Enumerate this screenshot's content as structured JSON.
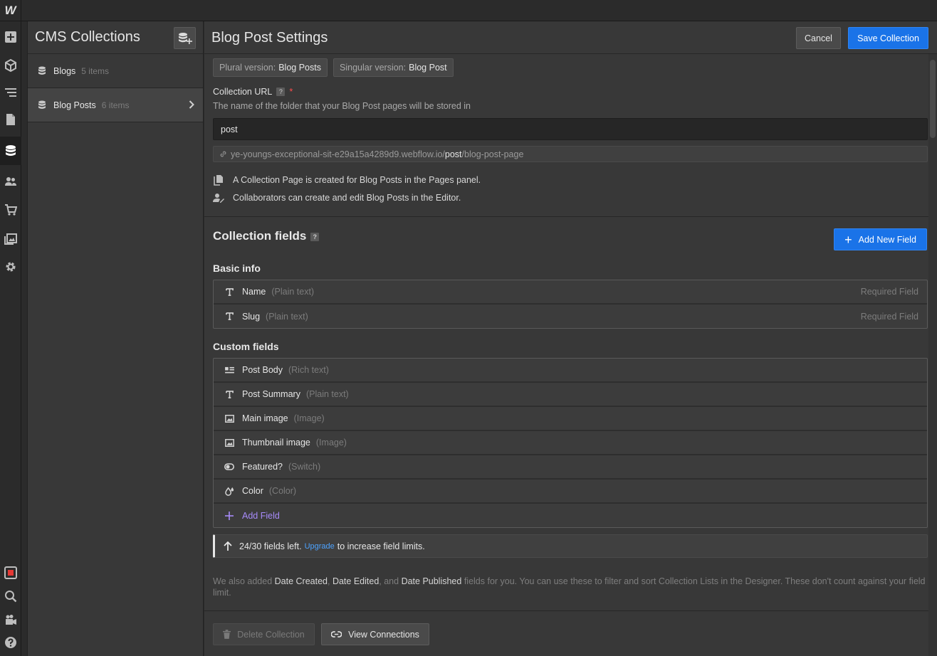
{
  "app": {
    "logo": "W"
  },
  "collections_panel": {
    "title": "CMS Collections",
    "items": [
      {
        "name": "Blogs",
        "count": "5 items"
      },
      {
        "name": "Blog Posts",
        "count": "6 items"
      }
    ]
  },
  "settings": {
    "title": "Blog Post Settings",
    "cancel_label": "Cancel",
    "save_label": "Save Collection",
    "plural_label": "Plural version:",
    "plural_value": "Blog Posts",
    "singular_label": "Singular version:",
    "singular_value": "Blog Post",
    "url_label": "Collection URL",
    "url_help": "?",
    "url_required": "*",
    "url_hint": "The name of the folder that your Blog Post pages will be stored in",
    "url_value": "post",
    "url_preview_domain": "ye-youngs-exceptional-sit-e29a15a4289d9.webflow.io/",
    "url_preview_folder": "post",
    "url_preview_page": "/blog-post-page",
    "info_pages": "A Collection Page is created for Blog Posts in the Pages panel.",
    "info_editor": "Collaborators can create and edit Blog Posts in the Editor."
  },
  "fields": {
    "section_title": "Collection fields",
    "section_help": "?",
    "add_new_label": "Add New Field",
    "basic_title": "Basic info",
    "basic": [
      {
        "name": "Name",
        "type": "(Plain text)",
        "required": "Required Field",
        "icon": "text-icon"
      },
      {
        "name": "Slug",
        "type": "(Plain text)",
        "required": "Required Field",
        "icon": "text-icon"
      }
    ],
    "custom_title": "Custom fields",
    "custom": [
      {
        "name": "Post Body",
        "type": "(Rich text)",
        "icon": "rich-text-icon"
      },
      {
        "name": "Post Summary",
        "type": "(Plain text)",
        "icon": "text-icon"
      },
      {
        "name": "Main image",
        "type": "(Image)",
        "icon": "image-icon"
      },
      {
        "name": "Thumbnail image",
        "type": "(Image)",
        "icon": "image-icon"
      },
      {
        "name": "Featured?",
        "type": "(Switch)",
        "icon": "switch-icon"
      },
      {
        "name": "Color",
        "type": "(Color)",
        "icon": "color-icon"
      }
    ],
    "add_field_label": "Add Field",
    "limit_count": "24/30 fields left.",
    "limit_upgrade": "Upgrade",
    "limit_suffix": "to increase field limits.",
    "note_1": "We also added ",
    "note_date_created": "Date Created",
    "note_2": ", ",
    "note_date_edited": "Date Edited",
    "note_3": ", and ",
    "note_date_published": "Date Published",
    "note_4": " fields for you. You can use these to filter and sort Collection Lists in the Designer. These don't count against your field limit."
  },
  "footer": {
    "delete_label": "Delete Collection",
    "view_label": "View Connections"
  },
  "colors": {
    "accent": "#1a73e8",
    "add_field": "#a78bfa",
    "required": "#ff4d4d",
    "link": "#4da3ff"
  }
}
